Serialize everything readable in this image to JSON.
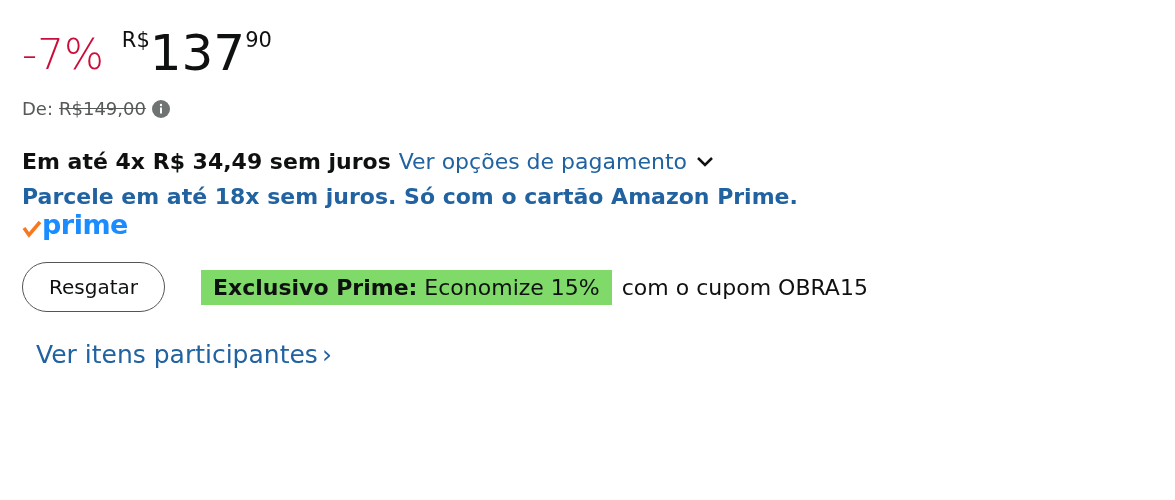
{
  "price": {
    "discount": "-7%",
    "currency": "R$",
    "whole": "137",
    "fraction": "90"
  },
  "list_price": {
    "label": "De:",
    "value": "R$149,00"
  },
  "installments": {
    "text": "Em até 4x R$ 34,49 sem juros",
    "link": "Ver opções de pagamento"
  },
  "card_offer": "Parcele em até 18x sem juros. Só com o cartão Amazon Prime.",
  "prime_logo": "prime",
  "coupon": {
    "button": "Resgatar",
    "badge": "**Exclusivo Prime:** Economize 15%",
    "text": "com o cupom OBRA15"
  },
  "participating_link": {
    "text": "Ver itens participantes",
    "chevron": "›"
  }
}
